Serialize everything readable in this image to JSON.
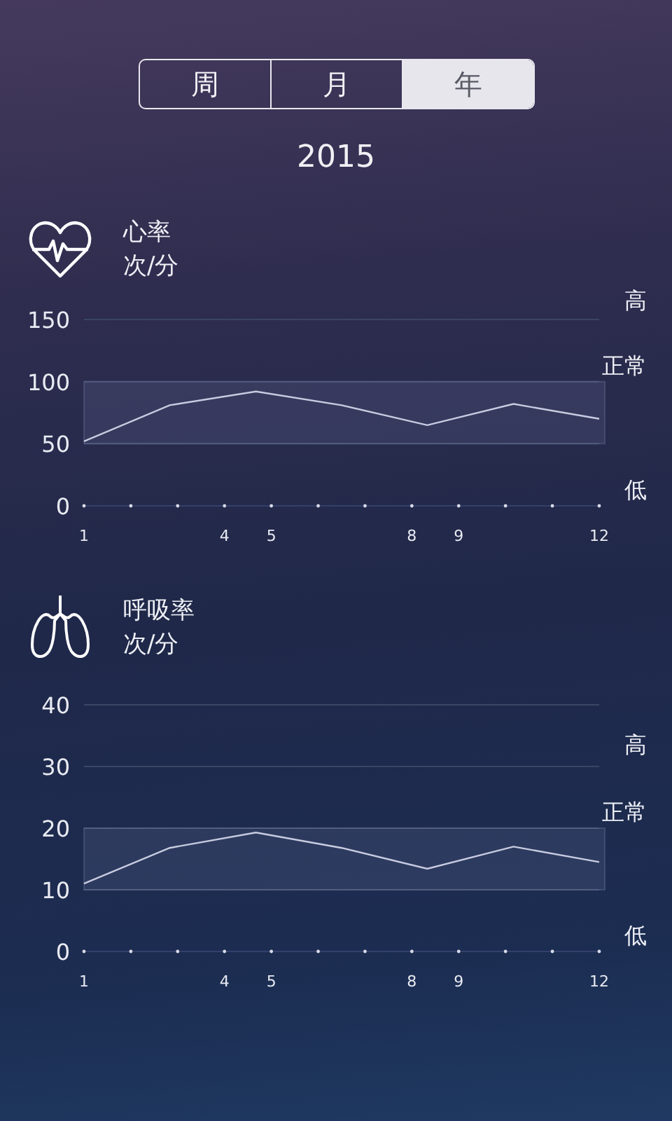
{
  "period_tabs": [
    {
      "label": "周",
      "selected": false
    },
    {
      "label": "月",
      "selected": false
    },
    {
      "label": "年",
      "selected": true
    }
  ],
  "year": "2015",
  "sections": [
    {
      "kind": "heart",
      "title": "心率",
      "unit": "次/分",
      "level_labels": [
        "高",
        "正常",
        "低"
      ],
      "chart_data": {
        "type": "line",
        "x": [
          1,
          2.83,
          4.67,
          6.5,
          8.33,
          10.17,
          12
        ],
        "series": [
          {
            "color": "#c8cce0",
            "values": [
              52,
              81,
              92,
              81,
              65,
              82,
              70
            ]
          }
        ],
        "xlim": [
          1,
          12
        ],
        "ylim": [
          0,
          150
        ],
        "xticks": [
          1,
          4,
          5,
          8,
          9,
          12
        ],
        "yticks": [
          0,
          50,
          100,
          150
        ],
        "grid": true,
        "bands": [
          {
            "axis": "y",
            "from": 50,
            "to": 100
          }
        ]
      }
    },
    {
      "kind": "lungs",
      "title": "呼吸率",
      "unit": "次/分",
      "level_labels": [
        "高",
        "正常",
        "低"
      ],
      "chart_data": {
        "type": "line",
        "x": [
          1,
          2.83,
          4.67,
          6.5,
          8.33,
          10.17,
          12
        ],
        "series": [
          {
            "color": "#c8cce0",
            "values": [
              11,
              16.8,
              19.3,
              16.8,
              13.4,
              17,
              14.5
            ]
          }
        ],
        "xlim": [
          1,
          12
        ],
        "ylim": [
          0,
          40
        ],
        "xticks": [
          1,
          4,
          5,
          8,
          9,
          12
        ],
        "yticks": [
          0,
          10,
          20,
          30,
          40
        ],
        "grid": true,
        "bands": [
          {
            "axis": "y",
            "from": 10,
            "to": 20
          }
        ]
      }
    }
  ]
}
